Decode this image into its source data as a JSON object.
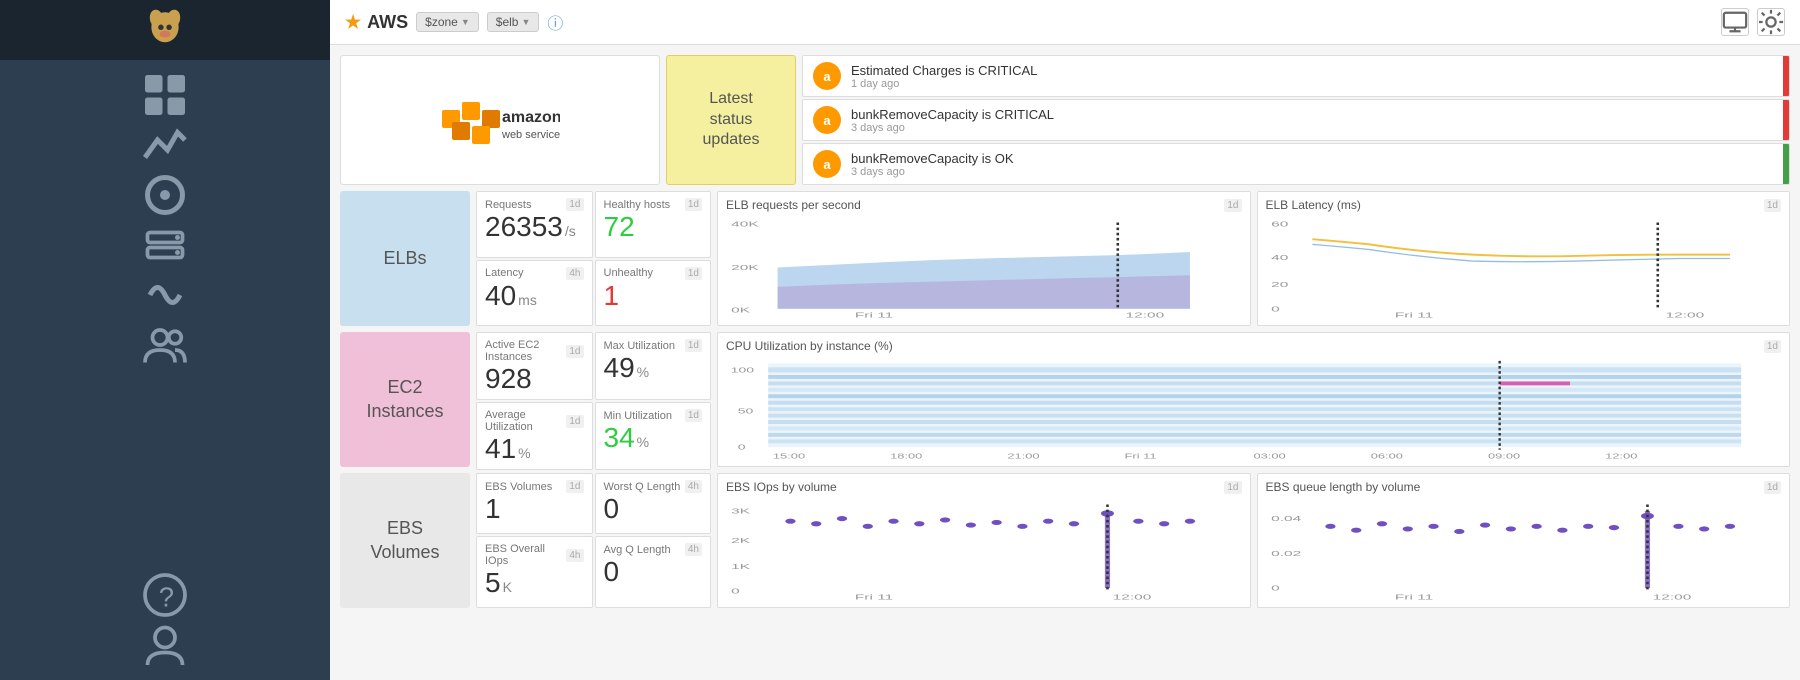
{
  "sidebar": {
    "logo_text": "🐕",
    "items": [
      {
        "name": "dashboards",
        "icon": "▦",
        "active": false
      },
      {
        "name": "metrics",
        "icon": "📈",
        "active": false
      },
      {
        "name": "monitors",
        "icon": "🔔",
        "active": false
      },
      {
        "name": "infrastructure",
        "icon": "🖥",
        "active": false
      },
      {
        "name": "apm",
        "icon": "↻",
        "active": false
      },
      {
        "name": "team",
        "icon": "👥",
        "active": false
      }
    ],
    "bottom_items": [
      {
        "name": "help",
        "icon": "?"
      },
      {
        "name": "account",
        "icon": "👤"
      }
    ]
  },
  "header": {
    "title": "AWS",
    "star": "★",
    "filter1": "$zone",
    "filter2": "$elb",
    "help_icon": "?",
    "monitor_icon": "🖥",
    "settings_icon": "⚙"
  },
  "hero": {
    "latest_status": "Latest\nstatus\nupdates"
  },
  "alerts": [
    {
      "title": "Estimated Charges is CRITICAL",
      "time": "1 day ago",
      "type": "critical"
    },
    {
      "title": "bunkRemoveCapacity is CRITICAL",
      "time": "3 days ago",
      "type": "critical"
    },
    {
      "title": "bunkRemoveCapacity is OK",
      "time": "3 days ago",
      "type": "ok"
    }
  ],
  "elb": {
    "label": "ELBs",
    "metrics": [
      {
        "label": "Requests",
        "period": "1d",
        "value": "26353",
        "unit": "/s",
        "color": "normal"
      },
      {
        "label": "Healthy hosts",
        "period": "1d",
        "value": "72",
        "unit": "",
        "color": "green"
      },
      {
        "label": "Latency",
        "period": "4h",
        "value": "40",
        "unit": "ms",
        "color": "normal"
      },
      {
        "label": "Unhealthy",
        "period": "1d",
        "value": "1",
        "unit": "",
        "color": "red"
      }
    ],
    "chart1": {
      "title": "ELB requests per second",
      "period": "1d",
      "x_labels": [
        "Fri 11",
        "12:00"
      ]
    },
    "chart2": {
      "title": "ELB Latency (ms)",
      "period": "1d",
      "x_labels": [
        "Fri 11",
        "12:00"
      ],
      "y_labels": [
        "60",
        "40",
        "20",
        "0"
      ]
    }
  },
  "ec2": {
    "label": "EC2\nInstances",
    "metrics": [
      {
        "label": "Active EC2 Instances",
        "period": "1d",
        "value": "928",
        "unit": "",
        "color": "normal"
      },
      {
        "label": "Max Utilization",
        "period": "1d",
        "value": "49",
        "unit": "%",
        "color": "normal"
      },
      {
        "label": "Average Utilization",
        "period": "1d",
        "value": "41",
        "unit": "%",
        "color": "normal"
      },
      {
        "label": "Min Utilization",
        "period": "1d",
        "value": "34",
        "unit": "%",
        "color": "green"
      }
    ],
    "chart": {
      "title": "CPU Utilization by instance (%)",
      "period": "1d",
      "y_labels": [
        "100",
        "50",
        "0"
      ],
      "x_labels": [
        "15:00",
        "18:00",
        "21:00",
        "Fri 11",
        "03:00",
        "06:00",
        "09:00",
        "12:00"
      ]
    }
  },
  "ebs": {
    "label": "EBS\nVolumes",
    "metrics": [
      {
        "label": "EBS Volumes",
        "period": "1d",
        "value": "1",
        "unit": "",
        "color": "normal"
      },
      {
        "label": "Worst Q Length",
        "period": "4h",
        "value": "0",
        "unit": "",
        "color": "normal"
      },
      {
        "label": "EBS Overall IOps",
        "period": "4h",
        "value": "5",
        "unit": "K",
        "color": "normal"
      },
      {
        "label": "Avg Q Length",
        "period": "4h",
        "value": "0",
        "unit": "",
        "color": "normal"
      }
    ],
    "chart1": {
      "title": "EBS IOps by volume",
      "period": "1d",
      "y_labels": [
        "3K",
        "2K",
        "1K",
        "0"
      ],
      "x_labels": [
        "Fri 11",
        "12:00"
      ]
    },
    "chart2": {
      "title": "EBS queue length by volume",
      "period": "1d",
      "y_labels": [
        "0.04",
        "0.02",
        "0"
      ],
      "x_labels": [
        "Fri 11",
        "12:00"
      ]
    }
  }
}
